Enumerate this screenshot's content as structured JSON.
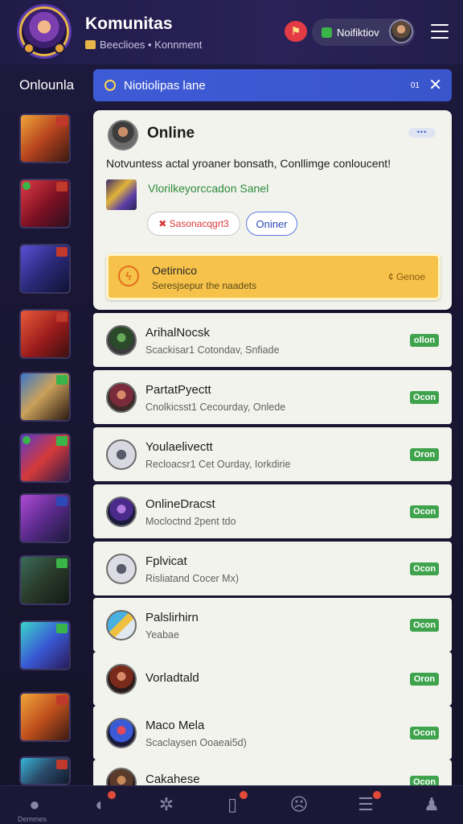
{
  "header": {
    "title": "Komunitas",
    "subtitle": "Beeclioes • Konnment",
    "notification_pill": "Noifiktiov"
  },
  "section": {
    "title": "Onlounla"
  },
  "search": {
    "placeholder": "Niotiolipas lane",
    "count": "01"
  },
  "main_card": {
    "title": "Online",
    "dots": "•••",
    "body_text": "Notvuntess actal yroaner bonsath, Conllimge conloucent!",
    "link_text": "Vlorilkeyorccadon Sanel",
    "button_red_label": "✖ Sasonacqgrt3",
    "button_blue_label": "Oniner",
    "alert": {
      "title": "Oetirnico",
      "subtitle": "Seresjsepur the naadets",
      "action": "¢ Genoe"
    }
  },
  "rows": [
    {
      "name": "ArihalNocsk",
      "sub": "Scackisar1 Cotondav, Snfiade",
      "badge": "ollon"
    },
    {
      "name": "PartatPyectt",
      "sub": "Cnolkicsst1 Cecourday, Onlede",
      "badge": "Ocon"
    },
    {
      "name": "Youlaelivectt",
      "sub": "Recloacsr1 Cet Ourday, Iorkdirie",
      "badge": "Oron"
    },
    {
      "name": "OnlineDracst",
      "sub": "Mocloctnd 2pent tdo",
      "badge": "Ocon"
    },
    {
      "name": "Fplvicat",
      "sub": "Risliatand Cocer Mx)",
      "badge": "Ocon"
    },
    {
      "name": "Palslirhirn",
      "sub": "Yeabae",
      "badge": "Ocon"
    },
    {
      "name": "Vorladtald",
      "sub": "",
      "badge": "Oron"
    },
    {
      "name": "Maco Mela",
      "sub": "Scaclaysen Ooaeai5d)",
      "badge": "Ocon"
    },
    {
      "name": "Cakahese",
      "sub": "",
      "badge": "Ocon"
    }
  ],
  "bottom_nav": {
    "first_label": "Demmes"
  },
  "colors": {
    "background": "#1b1836",
    "accent_blue": "#3e5bd6",
    "online_green": "#3fa34d",
    "alert_yellow": "#f6c24a"
  }
}
